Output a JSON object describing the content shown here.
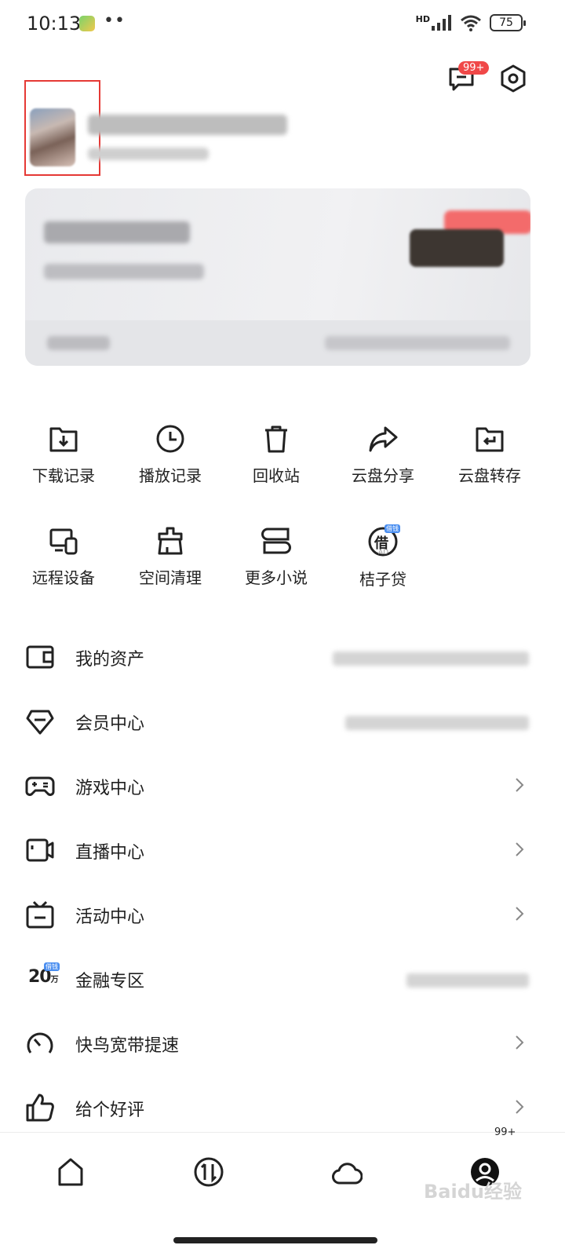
{
  "status": {
    "time": "10:13",
    "dots": "••",
    "network": "HD",
    "battery": "75"
  },
  "header": {
    "message_badge": "99+"
  },
  "grid": [
    {
      "label": "下载记录",
      "icon": "download-folder-icon"
    },
    {
      "label": "播放记录",
      "icon": "clock-icon"
    },
    {
      "label": "回收站",
      "icon": "trash-icon"
    },
    {
      "label": "云盘分享",
      "icon": "share-arrow-icon"
    },
    {
      "label": "云盘转存",
      "icon": "folder-return-icon"
    },
    {
      "label": "远程设备",
      "icon": "devices-icon"
    },
    {
      "label": "空间清理",
      "icon": "clean-brush-icon"
    },
    {
      "label": "更多小说",
      "icon": "books-icon"
    },
    {
      "label": "桔子贷",
      "icon": "loan-icon",
      "badge": "借钱",
      "sub": "AD",
      "glyph": "借"
    }
  ],
  "list": [
    {
      "label": "我的资产",
      "icon": "wallet-icon"
    },
    {
      "label": "会员中心",
      "icon": "diamond-icon"
    },
    {
      "label": "游戏中心",
      "icon": "gamepad-icon"
    },
    {
      "label": "直播中心",
      "icon": "video-camera-icon"
    },
    {
      "label": "活动中心",
      "icon": "tv-icon"
    },
    {
      "label": "金融专区",
      "icon": "finance-icon",
      "glyph": "20",
      "glyph_sub": "万",
      "badge": "借钱"
    },
    {
      "label": "快鸟宽带提速",
      "icon": "speedometer-icon"
    },
    {
      "label": "给个好评",
      "icon": "thumbs-up-icon"
    }
  ],
  "tabbar": {
    "badge": "99+"
  },
  "watermark": "Baidu经验"
}
